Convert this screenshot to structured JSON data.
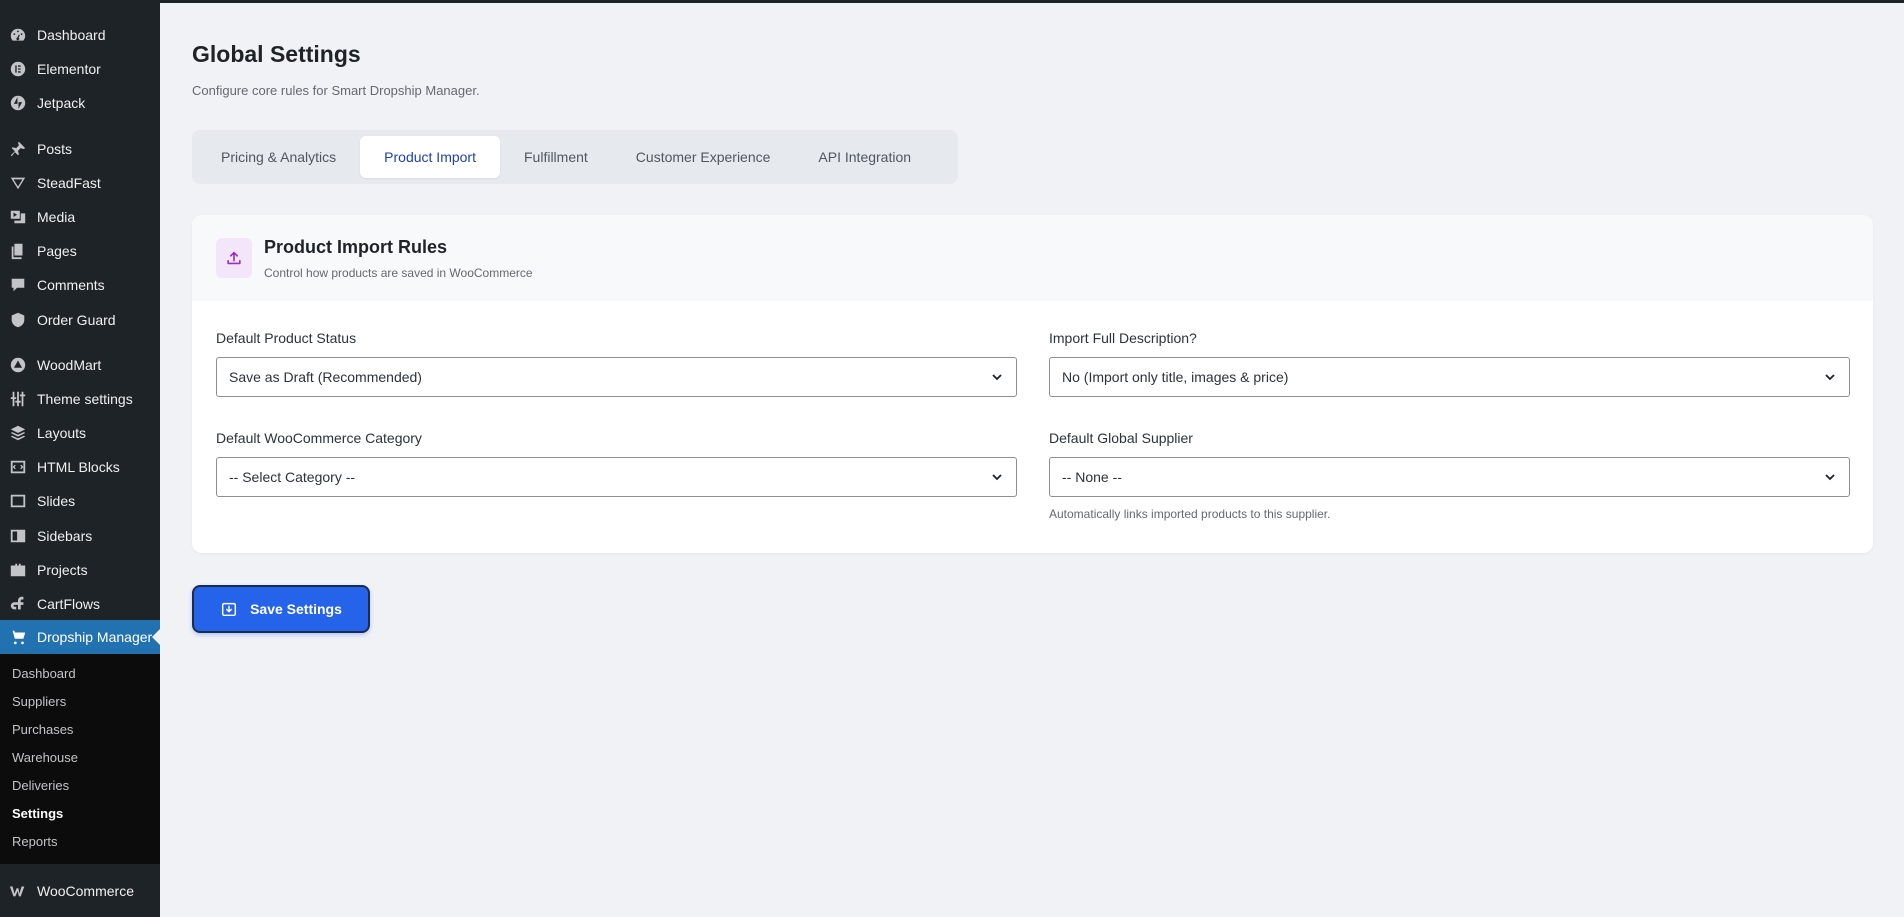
{
  "sidebar": {
    "items": [
      {
        "label": "Dashboard",
        "icon": "dashboard-icon"
      },
      {
        "label": "Elementor",
        "icon": "elementor-icon"
      },
      {
        "label": "Jetpack",
        "icon": "jetpack-icon"
      },
      {
        "label": "Posts",
        "icon": "pin-icon"
      },
      {
        "label": "SteadFast",
        "icon": "steadfast-icon"
      },
      {
        "label": "Media",
        "icon": "media-icon"
      },
      {
        "label": "Pages",
        "icon": "pages-icon"
      },
      {
        "label": "Comments",
        "icon": "comments-icon"
      },
      {
        "label": "Order Guard",
        "icon": "shield-icon"
      },
      {
        "label": "WoodMart",
        "icon": "woodmart-icon"
      },
      {
        "label": "Theme settings",
        "icon": "sliders-icon"
      },
      {
        "label": "Layouts",
        "icon": "layers-icon"
      },
      {
        "label": "HTML Blocks",
        "icon": "code-icon"
      },
      {
        "label": "Slides",
        "icon": "slides-icon"
      },
      {
        "label": "Sidebars",
        "icon": "sidebars-icon"
      },
      {
        "label": "Projects",
        "icon": "briefcase-icon"
      },
      {
        "label": "CartFlows",
        "icon": "cartflows-icon"
      },
      {
        "label": "Dropship Manager",
        "icon": "cart-icon"
      },
      {
        "label": "WooCommerce",
        "icon": "woocommerce-icon"
      }
    ],
    "submenu": [
      "Dashboard",
      "Suppliers",
      "Purchases",
      "Warehouse",
      "Deliveries",
      "Settings",
      "Reports"
    ],
    "active_item": "Dropship Manager",
    "current_submenu": "Settings"
  },
  "page": {
    "title": "Global Settings",
    "subtitle": "Configure core rules for Smart Dropship Manager."
  },
  "tabs": [
    {
      "label": "Pricing & Analytics",
      "active": false
    },
    {
      "label": "Product Import",
      "active": true
    },
    {
      "label": "Fulfillment",
      "active": false
    },
    {
      "label": "Customer Experience",
      "active": false
    },
    {
      "label": "API Integration",
      "active": false
    }
  ],
  "card": {
    "icon": "upload-icon",
    "title": "Product Import Rules",
    "description": "Control how products are saved in WooCommerce",
    "fields": {
      "product_status": {
        "label": "Default Product Status",
        "value": "Save as Draft (Recommended)"
      },
      "full_description": {
        "label": "Import Full Description?",
        "value": "No (Import only title, images & price)"
      },
      "category": {
        "label": "Default WooCommerce Category",
        "value": "-- Select Category --"
      },
      "supplier": {
        "label": "Default Global Supplier",
        "value": "-- None --",
        "help": "Automatically links imported products to this supplier."
      }
    }
  },
  "save_button": {
    "label": "Save Settings",
    "icon": "save-icon"
  },
  "colors": {
    "sidebar_bg": "#1d2327",
    "active_menu": "#2271b1",
    "primary_button": "#2563eb",
    "active_tab_text": "#1e3fb8",
    "icon_tile_bg": "#f3e6fb"
  }
}
